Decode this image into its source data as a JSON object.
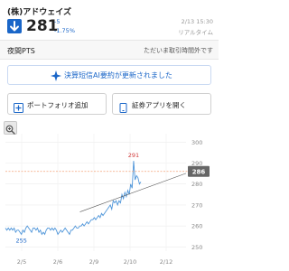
{
  "header": {
    "stock_name": "(株)アドウェイズ",
    "price": "281",
    "change": "-5",
    "change_pct": "-1.75%",
    "time": "2/13 15:30",
    "realtime": "リアルタイム"
  },
  "pts": {
    "label": "夜間PTS",
    "status": "ただいま取引時間外です"
  },
  "notice": {
    "text": "決算短信AI要約が更新されました"
  },
  "actions": {
    "portfolio": "ポートフォリオ追加",
    "app": "証券アプリを開く"
  },
  "colors": {
    "accent_blue": "#1a66c8",
    "chart_line": "#4e95d9",
    "current_line": "#f4a37a",
    "price_badge": "#666666",
    "max_label": "#d23c3c",
    "min_label": "#1a66c8"
  },
  "chart_data": {
    "type": "line",
    "x_ticks": [
      "2/5",
      "2/6",
      "2/9",
      "2/10",
      "2/12"
    ],
    "y_ticks": [
      300,
      290,
      280,
      270,
      260,
      250
    ],
    "ylim": [
      248,
      304
    ],
    "current_price": 286,
    "current_price_label": "286",
    "max_label": "291",
    "min_label": "255",
    "series": [
      {
        "values": [
          259,
          258,
          259,
          258,
          259,
          258,
          259,
          257,
          258,
          258,
          257,
          256,
          258,
          257,
          259,
          260,
          259,
          258,
          257,
          259,
          259,
          258,
          259,
          257,
          258,
          256,
          257,
          256,
          258,
          259,
          259,
          258,
          259,
          258,
          259,
          258,
          256,
          257,
          258,
          257,
          258,
          259,
          258,
          257,
          256,
          258,
          258,
          259,
          260,
          259,
          259,
          260,
          260,
          261,
          260,
          261,
          262,
          261,
          262,
          263,
          263,
          264,
          263,
          264,
          265,
          264,
          266,
          265,
          266,
          267,
          268,
          269,
          270,
          268,
          272,
          271,
          272,
          270,
          272,
          271,
          275,
          273,
          276,
          274,
          277,
          275,
          280,
          278,
          291,
          282,
          284,
          283,
          280,
          281
        ]
      },
      {
        "values": [
          256.5,
          256.7,
          256.9,
          257.1,
          257.3,
          257.5,
          257.7,
          257.9,
          258.1,
          258.3,
          258.5,
          258.7,
          258.9,
          259.1,
          259.3,
          259.5,
          259.7,
          259.9,
          260.1,
          260.3,
          260.5,
          260.7,
          260.9,
          261.1,
          261.3,
          261.5,
          261.7,
          261.9,
          262.1,
          262.3,
          262.5,
          262.7,
          262.9,
          263.1,
          263.3,
          263.5,
          263.7,
          263.9,
          264.1,
          264.3,
          264.5,
          264.7,
          264.9,
          265.1,
          265.3,
          265.5,
          265.7,
          265.9,
          266.1,
          266.3,
          266.5,
          266.7,
          266.9,
          267.1,
          267.3,
          267.5,
          267.7,
          267.9,
          268.1,
          268.3,
          268.5,
          268.7,
          268.9,
          269.1,
          269.3,
          269.5,
          269.7,
          269.9,
          270.1,
          270.3,
          270.5,
          270.7,
          270.9,
          271.1,
          271.3,
          271.5,
          271.7,
          271.9,
          272.1,
          272.3,
          272.5,
          272.7,
          272.9,
          273.1,
          273.3,
          273.5,
          273.7,
          273.9,
          274.1,
          274.3,
          274.5,
          274.7,
          274.9,
          275.1
        ]
      }
    ]
  }
}
